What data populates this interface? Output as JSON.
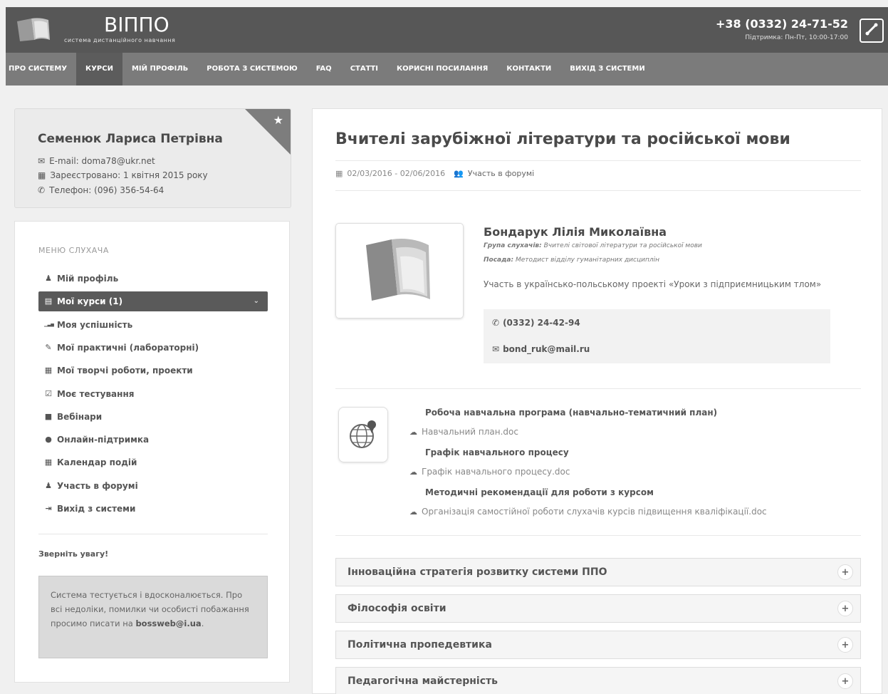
{
  "header": {
    "logo_title": "ВІППО",
    "logo_subtitle": "система дистанційного навчання",
    "phone": "+38 (0332) 24-71-52",
    "support": "Підтримка: Пн-Пт, 10:00-17:00"
  },
  "nav": {
    "items": [
      {
        "label": "ПРО СИСТЕМУ"
      },
      {
        "label": "КУРСИ"
      },
      {
        "label": "МІЙ ПРОФІЛЬ"
      },
      {
        "label": "РОБОТА З СИСТЕМОЮ"
      },
      {
        "label": "FAQ"
      },
      {
        "label": "СТАТТІ"
      },
      {
        "label": "КОРИСНІ ПОСИЛАННЯ"
      },
      {
        "label": "КОНТАКТИ"
      },
      {
        "label": "ВИХІД З СИСТЕМИ"
      }
    ],
    "active_index": 1
  },
  "profile": {
    "name": "Семенюк Лариса Петрівна",
    "email": "E-mail: doma78@ukr.net",
    "registered": "Зареєстровано: 1 квітня 2015 року",
    "phone": "Телефон: (096) 356-54-64"
  },
  "menu": {
    "heading": "МЕНЮ СЛУХАЧА",
    "items": [
      {
        "label": "Мій профіль",
        "icon": "user-icon"
      },
      {
        "label": "Мої курси (1)",
        "icon": "book-icon"
      },
      {
        "label": "Моя успішність",
        "icon": "signal-icon"
      },
      {
        "label": "Мої практичні (лабораторні)",
        "icon": "pencil-icon"
      },
      {
        "label": "Мої творчі роботи, проекти",
        "icon": "file-icon"
      },
      {
        "label": "Моє тестування",
        "icon": "checkbox-icon"
      },
      {
        "label": "Вебінари",
        "icon": "video-icon"
      },
      {
        "label": "Онлайн-підтримка",
        "icon": "chat-icon"
      },
      {
        "label": "Календар подій",
        "icon": "calendar-icon"
      },
      {
        "label": "Участь в форумі",
        "icon": "group-icon"
      },
      {
        "label": "Вихід з системи",
        "icon": "logout-icon"
      }
    ],
    "active_index": 1,
    "attention_title": "Зверніть увагу!",
    "notice_text": "Система тестується і вдосконалюється. Про всі недоліки, помилки чи особисті побажання просимо писати на",
    "notice_email": "bossweb@i.ua"
  },
  "course": {
    "title": "Вчителі зарубіжної літератури та російської мови",
    "dates": "02/03/2016 - 02/06/2016",
    "forum": "Участь в форумі"
  },
  "teacher": {
    "name": "Бондарук Лілія Миколаївна",
    "group_label": "Група слухачів:",
    "group_value": "Вчителі світової літератури та російської мови",
    "position_label": "Посада:",
    "position_value": "Методист відділу гуманітарних дисциплін",
    "description": "Участь в українсько-польському проекті «Уроки з підприємницьким тлом»",
    "phone": "(0332) 24-42-94",
    "email": "bond_ruk@mail.ru"
  },
  "documents": {
    "program_title": "Робоча навчальна програма (навчально-тематичний план)",
    "program_file": "Навчальний план.doc",
    "schedule_title": "Графік навчального процесу",
    "schedule_file": "Графік навчального процесу.doc",
    "method_title": "Методичні рекомендації для роботи з курсом",
    "method_file": "Організація самостійної роботи слухачів курсів підвищення кваліфікації.doc"
  },
  "accordion": [
    {
      "label": "Інноваційна стратегія розвитку системи ППО"
    },
    {
      "label": "Філософія освіти"
    },
    {
      "label": "Політична пропедевтика"
    },
    {
      "label": "Педагогічна майстерність"
    }
  ]
}
